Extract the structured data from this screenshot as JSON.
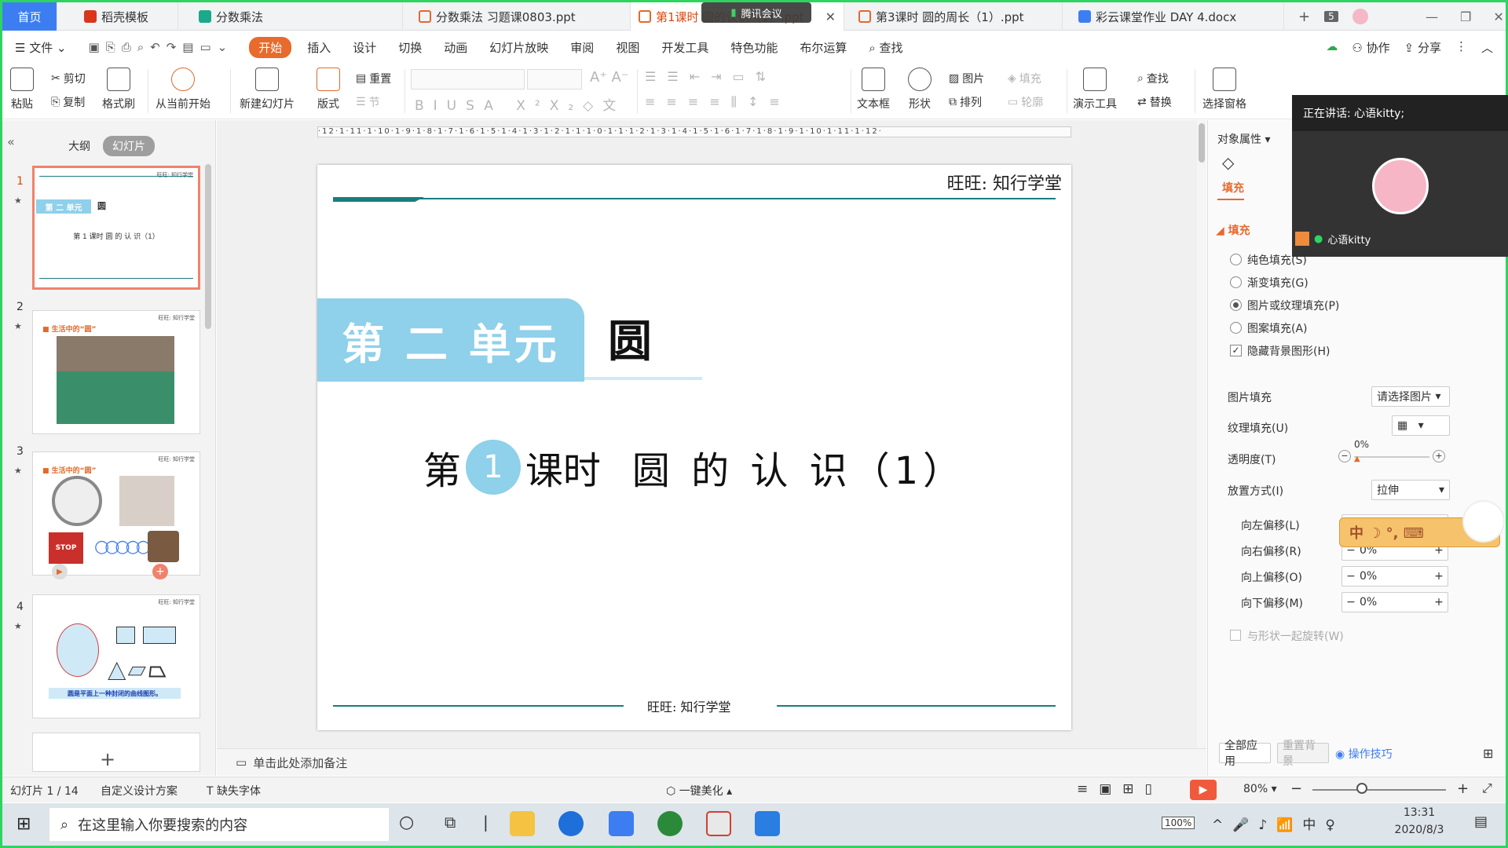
{
  "tabs": [
    {
      "label": "首页",
      "kind": "home"
    },
    {
      "label": "稻壳模板",
      "icon": "docer-icon"
    },
    {
      "label": "分数乘法",
      "icon": "mindmap-icon"
    },
    {
      "label": "分数乘法 习题课0803.ppt",
      "icon": "ppt-icon"
    },
    {
      "label": "第1课时 圆的认识（1）.ppt",
      "icon": "ppt-icon",
      "active": true
    },
    {
      "label": "第3课时 圆的周长（1）.ppt",
      "icon": "ppt-icon"
    },
    {
      "label": "彩云课堂作业 DAY 4.docx",
      "icon": "word-icon"
    }
  ],
  "tab_count": "5",
  "meeting_float_label": "腾讯会议",
  "menu": {
    "file": "文件",
    "items": [
      "开始",
      "插入",
      "设计",
      "切换",
      "动画",
      "幻灯片放映",
      "审阅",
      "视图",
      "开发工具",
      "特色功能",
      "布尔运算"
    ],
    "search": "查找",
    "collab": "协作",
    "share": "分享"
  },
  "ribbon": {
    "paste": "粘贴",
    "cut": "剪切",
    "copy": "复制",
    "format_painter": "格式刷",
    "from_current": "从当前开始",
    "new_slide": "新建幻灯片",
    "layout": "版式",
    "reset": "重置",
    "section": "节",
    "textbox": "文本框",
    "shape": "形状",
    "picture": "图片",
    "arrange": "排列",
    "fill": "填充",
    "outline": "轮廓",
    "present_tools": "演示工具",
    "find": "查找",
    "replace": "替换",
    "select_pane": "选择窗格"
  },
  "left_panel": {
    "tab_outline": "大纲",
    "tab_slides": "幻灯片",
    "thumbs": [
      {
        "num": "1",
        "badge": "第 二 单元",
        "unit": "圆",
        "lesson": "第 1 课时  圆 的 认 识（1）",
        "header": "旺旺: 知行学堂"
      },
      {
        "num": "2",
        "title": "■ 生活中的“圆”",
        "header": "旺旺: 知行学堂"
      },
      {
        "num": "3",
        "title": "■ 生活中的“圆”",
        "header": "旺旺: 知行学堂"
      },
      {
        "num": "4",
        "caption": "圆是平面上一种封闭的曲线图形。",
        "header": "旺旺: 知行学堂"
      }
    ]
  },
  "slide": {
    "header": "旺旺: 知行学堂",
    "unit_badge": "第 二 单元",
    "unit_title": "圆",
    "lesson_prefix": "第",
    "lesson_num": "1",
    "lesson_suffix": "课时",
    "lesson_title": "圆 的 认 识（1）",
    "footer": "旺旺: 知行学堂"
  },
  "ruler_text": "·12·1·11·1·10·1·9·1·8·1·7·1·6·1·5·1·4·1·3·1·2·1·1·1·0·1·1·1·2·1·3·1·4·1·5·1·6·1·7·1·8·1·9·1·10·1·11·1·12·",
  "notes_placeholder": "单击此处添加备注",
  "right_panel": {
    "title": "对象属性",
    "fill_tab": "填充",
    "section": "填充",
    "options": [
      {
        "label": "纯色填充(S)",
        "checked": false
      },
      {
        "label": "渐变填充(G)",
        "checked": false
      },
      {
        "label": "图片或纹理填充(P)",
        "checked": true
      },
      {
        "label": "图案填充(A)",
        "checked": false
      }
    ],
    "hide_bg": "隐藏背景图形(H)",
    "picture_fill_label": "图片填充",
    "picture_fill_value": "请选择图片",
    "texture_label": "纹理填充(U)",
    "transparency_label": "透明度(T)",
    "transparency_value": "0%",
    "placement_label": "放置方式(I)",
    "placement_value": "拉伸",
    "offsets": [
      {
        "label": "向左偏移(L)",
        "value": "0%"
      },
      {
        "label": "向右偏移(R)",
        "value": "0%"
      },
      {
        "label": "向上偏移(O)",
        "value": "0%"
      },
      {
        "label": "向下偏移(M)",
        "value": "0%"
      }
    ],
    "rotate_with_shape": "与形状一起旋转(W)",
    "apply_all": "全部应用",
    "reset_bg": "重置背景",
    "tips": "操作技巧"
  },
  "meeting": {
    "speaking": "正在讲话: 心语kitty;",
    "name": "心语kitty"
  },
  "ime_bar": "中 ☽ °, ⌨",
  "status": {
    "slide_info": "幻灯片 1 / 14",
    "design": "自定义设计方案",
    "missing_font": "缺失字体",
    "beautify": "一键美化",
    "zoom": "80%"
  },
  "taskbar": {
    "search_placeholder": "在这里输入你要搜索的内容",
    "battery": "100%",
    "time": "13:31",
    "date": "2020/8/3"
  },
  "colors": {
    "accent_orange": "#e86a2c",
    "home_tab": "#3c7ef2",
    "slide_teal": "#1a7d7d",
    "badge_blue": "#8fd0ea",
    "frame_green": "#2fd35f"
  }
}
